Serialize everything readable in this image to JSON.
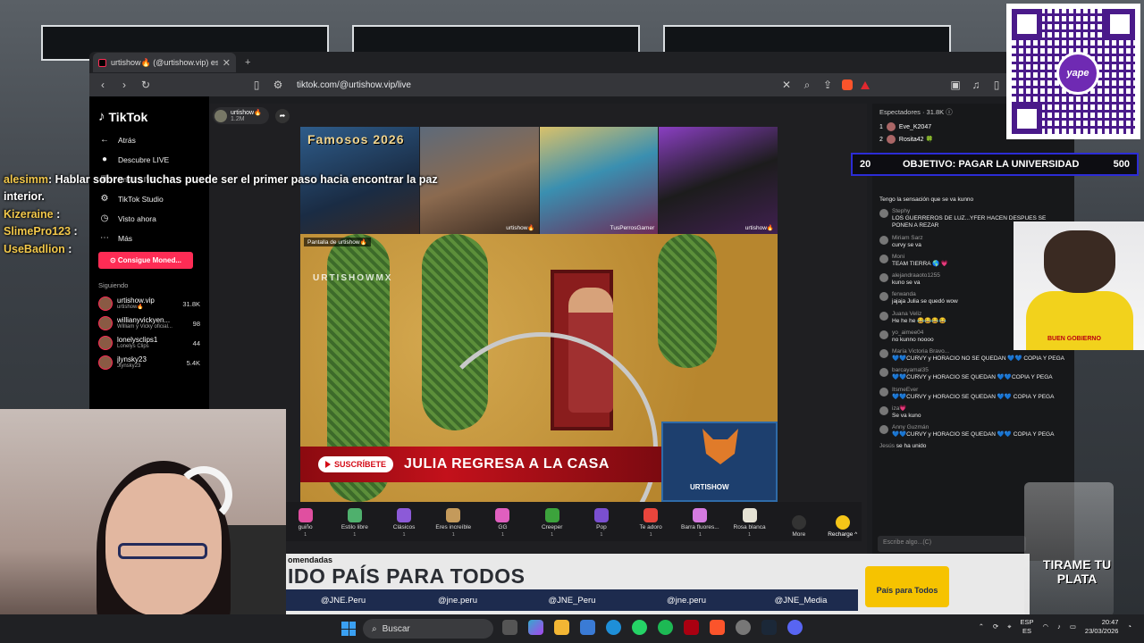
{
  "browser": {
    "tab_title": "urtishow🔥 (@urtishow.vip) está",
    "tab_close": "✕",
    "tab_new": "+",
    "url": "tiktok.com/@urtishow.vip/live"
  },
  "tiktok": {
    "logo": "TikTok",
    "nav": [
      {
        "icon": "arrow-left-icon",
        "glyph": "←",
        "label": "Atrás"
      },
      {
        "icon": "live-icon",
        "glyph": "●",
        "label": "Descubre LIVE"
      },
      {
        "icon": "broadcast-icon",
        "glyph": "▣",
        "label": "Emitir LIVE"
      },
      {
        "icon": "studio-icon",
        "glyph": "⚙",
        "label": "TikTok Studio"
      },
      {
        "icon": "history-icon",
        "glyph": "◷",
        "label": "Visto ahora"
      },
      {
        "icon": "more-icon",
        "glyph": "⋯",
        "label": "Más"
      }
    ],
    "coins_button": "⊙ Consigue Moned...",
    "following_heading": "Siguiendo",
    "following": [
      {
        "name": "urtishow.vip",
        "sub": "urtishow🔥",
        "count": "31.8K"
      },
      {
        "name": "willianyvickyen...",
        "sub": "William y Vicky oficial...",
        "count": "98"
      },
      {
        "name": "lonelysclips1",
        "sub": "Lonelys Clips",
        "count": "44"
      },
      {
        "name": "jlynsky23",
        "sub": "Jlynsky23",
        "count": "5.4K"
      }
    ]
  },
  "live": {
    "host_name": "urtishow🔥",
    "host_likes": "1.2M",
    "tile_title": "Famosos 2026",
    "tiles": [
      {
        "label": ""
      },
      {
        "label": "urtishow🔥"
      },
      {
        "label": "TusPerrosGamer"
      },
      {
        "label": "urtishow🔥"
      }
    ],
    "screen_label": "Pantalla de urtishow🔥",
    "watermark": "URTISHOWMX",
    "subscribe": "SUSCRÍBETE",
    "headline": "JULIA REGRESA A LA CASA",
    "fox_label": "URTISHOW",
    "gifts": [
      {
        "name": "guiño",
        "price": "1"
      },
      {
        "name": "Estilo libre",
        "price": "1"
      },
      {
        "name": "Clásicos",
        "price": "1"
      },
      {
        "name": "Eres increíble",
        "price": "1"
      },
      {
        "name": "GG",
        "price": "1"
      },
      {
        "name": "Creeper",
        "price": "1"
      },
      {
        "name": "Pop",
        "price": "1"
      },
      {
        "name": "Te adoro",
        "price": "1"
      },
      {
        "name": "Barra fluores...",
        "price": "1"
      },
      {
        "name": "Rosa blanca",
        "price": "1"
      }
    ],
    "more_label": "More",
    "recharge_label": "Recharge ^"
  },
  "chat": {
    "header": "Espectadores · 31.8K ⓘ",
    "viewers": [
      {
        "rank": "1",
        "name": "Eve_K2047"
      },
      {
        "rank": "2",
        "name": "Rosita42 🍀"
      }
    ],
    "messages": [
      {
        "user": "",
        "text": "Tengo la sensación que se va kunno"
      },
      {
        "user": "Stephy",
        "text": "LOS GUERREROS DE LUZ...YFER HACEN DESPUES SE PONEN A REZAR"
      },
      {
        "user": "Miriam Sarz",
        "text": "curvy se va"
      },
      {
        "user": "Moni",
        "text": "TEAM TIERRA 🌎 💗"
      },
      {
        "user": "alejandraaoto1255",
        "text": "kuno se va"
      },
      {
        "user": "ferwanda",
        "text": "jajaja Julia se quedó wow"
      },
      {
        "user": "Juana Veliz",
        "text": "He he he 😂😂😂😂"
      },
      {
        "user": "yo_aimee04",
        "text": "no kunno noooo"
      },
      {
        "user": "María Victoria Bravo...",
        "text": "💙💙CURVY y HORACIO NO SE QUEDAN 💙💙 COPIA Y PEGA"
      },
      {
        "user": "barcayamal35",
        "text": "💙💙CURVY y HORACIO SE QUEDAN 💙💙COPIA Y PEGA"
      },
      {
        "user": "ItsmeEver",
        "text": "💙💙CURVY y HORACIO SE QUEDAN 💙💙 COPIA Y PEGA"
      },
      {
        "user": "iza💗",
        "text": "Se va kuno"
      },
      {
        "user": "Anny Guzmán",
        "text": "💙💙CURVY y HORACIO SE QUEDAN 💙💙 COPIA Y PEGA"
      },
      {
        "user": "Jesús",
        "text": "se ha unido"
      }
    ],
    "input_placeholder": "Escribe algo...(C)"
  },
  "overlay": {
    "chat_lines": [
      {
        "user": "alesimm",
        "text": ": Hablar sobre tus luchas puede ser el primer paso hacia encontrar la paz interior."
      },
      {
        "user": "Kizeraine",
        "text": ":"
      },
      {
        "user": "SlimePro123",
        "text": ":"
      },
      {
        "user": "UseBadlion",
        "text": ":"
      }
    ],
    "goal_current": "20",
    "goal_text": "OBJETIVO: PAGAR LA UNIVERSIDAD",
    "goal_target": "500",
    "qr_brand": "yape",
    "dog_shirt": "BUEN GOBIERNO",
    "cup_text": "TIRAME TU PLATA",
    "recomend": "omendadas",
    "slogan": "IDO PAÍS PARA TODOS",
    "socials": [
      "@JNE.Peru",
      "@jne.peru",
      "@JNE_Peru",
      "@jne.peru",
      "@JNE_Media"
    ],
    "jne_logo": "País para Todos"
  },
  "taskbar": {
    "search": "Buscar",
    "lang": "ESP",
    "lang_sub": "ES",
    "time": "20:47",
    "date": "23/03/2026"
  },
  "colors": {
    "tiktok_red": "#fe2c55",
    "goal_border": "#2c2cd6",
    "overlay_user": "#f2c84b"
  }
}
